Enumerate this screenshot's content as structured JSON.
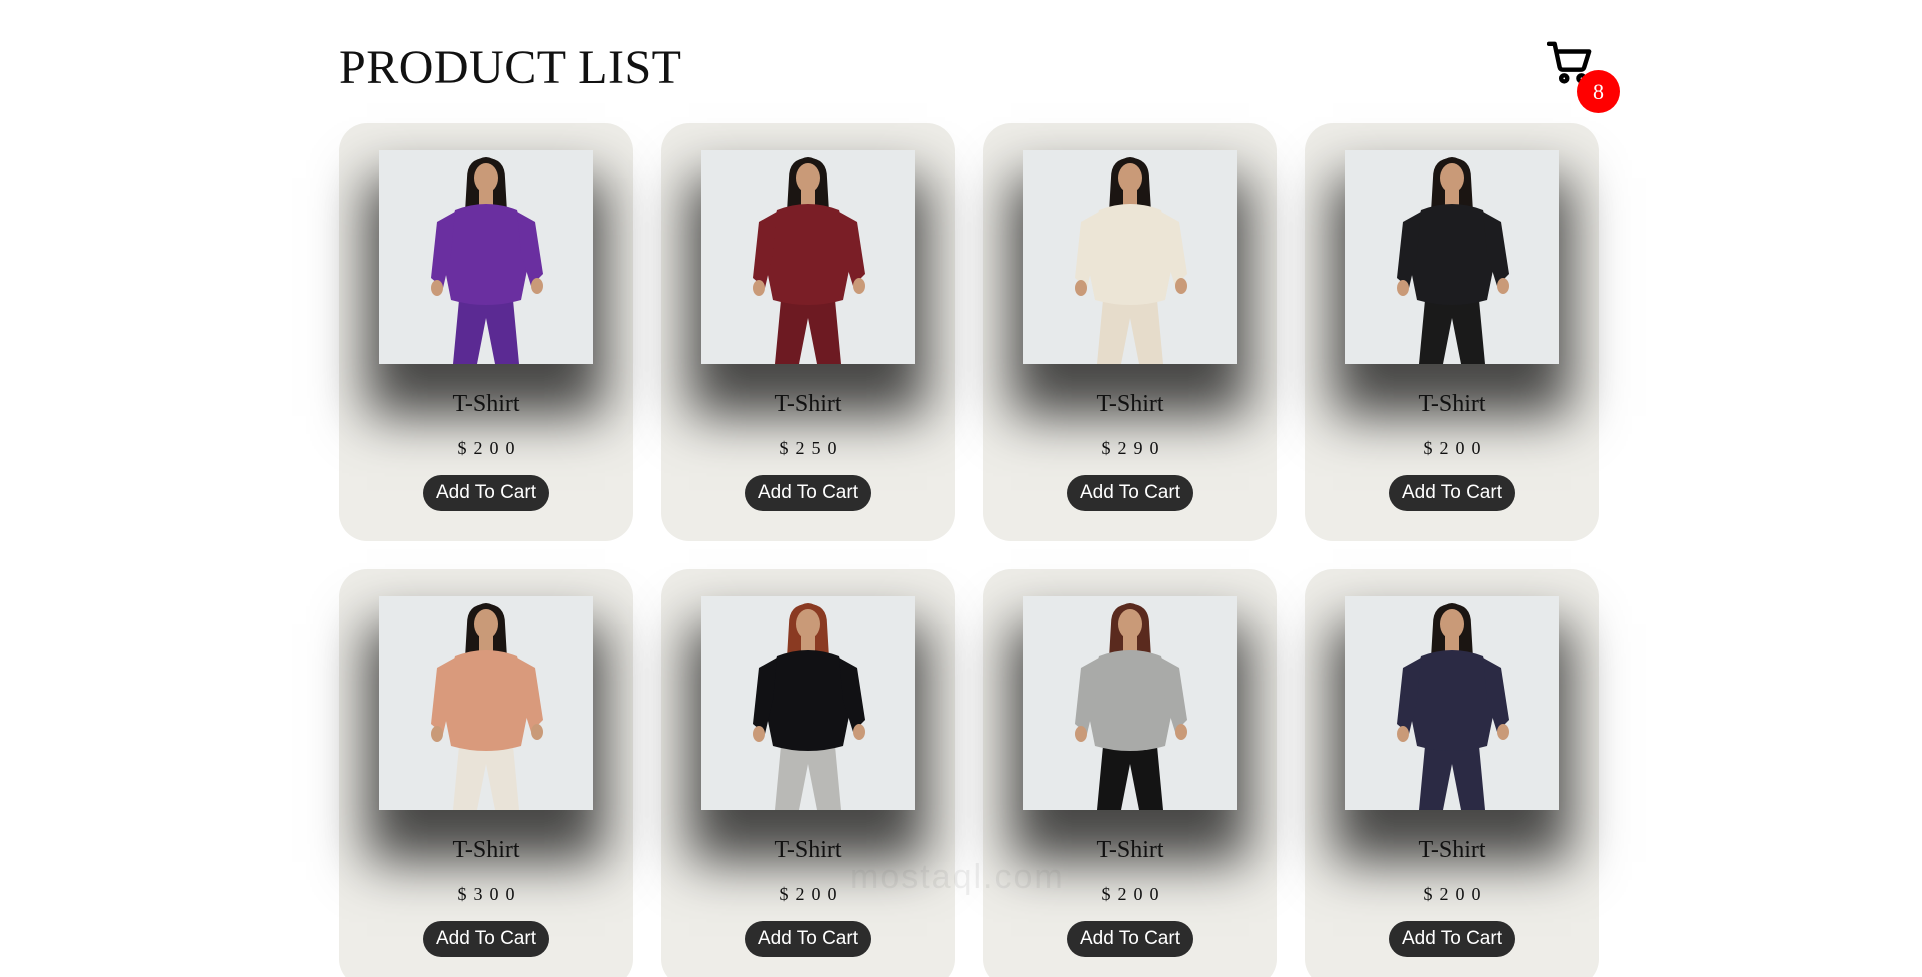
{
  "header": {
    "title": "PRODUCT LIST",
    "cart_icon": "shopping-cart-icon",
    "cart_count": "8"
  },
  "colors": {
    "card_bg": "#eeede8",
    "button_bg": "#2c2c2c",
    "badge_bg": "#ff0000",
    "photo_bg": "#e7eaeb"
  },
  "products": [
    {
      "name": "T-Shirt",
      "price": "$200",
      "button": "Add To Cart",
      "garment": "#6a2fa0",
      "pants": "#5b2a93",
      "hair": "#1b1512"
    },
    {
      "name": "T-Shirt",
      "price": "$250",
      "button": "Add To Cart",
      "garment": "#7a1e26",
      "pants": "#6d1a22",
      "hair": "#1b1512"
    },
    {
      "name": "T-Shirt",
      "price": "$290",
      "button": "Add To Cart",
      "garment": "#ece5d6",
      "pants": "#e6dccb",
      "hair": "#1b1512"
    },
    {
      "name": "T-Shirt",
      "price": "$200",
      "button": "Add To Cart",
      "garment": "#1c1c1f",
      "pants": "#1a1a1a",
      "hair": "#1b1512"
    },
    {
      "name": "T-Shirt",
      "price": "$300",
      "button": "Add To Cart",
      "garment": "#d99a7c",
      "pants": "#e9e3d8",
      "hair": "#1b1512"
    },
    {
      "name": "T-Shirt",
      "price": "$200",
      "button": "Add To Cart",
      "garment": "#111114",
      "pants": "#b9b9b6",
      "hair": "#8a3a22"
    },
    {
      "name": "T-Shirt",
      "price": "$200",
      "button": "Add To Cart",
      "garment": "#a9aaa8",
      "pants": "#141414",
      "hair": "#5a2a1e"
    },
    {
      "name": "T-Shirt",
      "price": "$200",
      "button": "Add To Cart",
      "garment": "#2b2a44",
      "pants": "#2b2a44",
      "hair": "#1b1512"
    }
  ],
  "watermark": "mostaql.com"
}
